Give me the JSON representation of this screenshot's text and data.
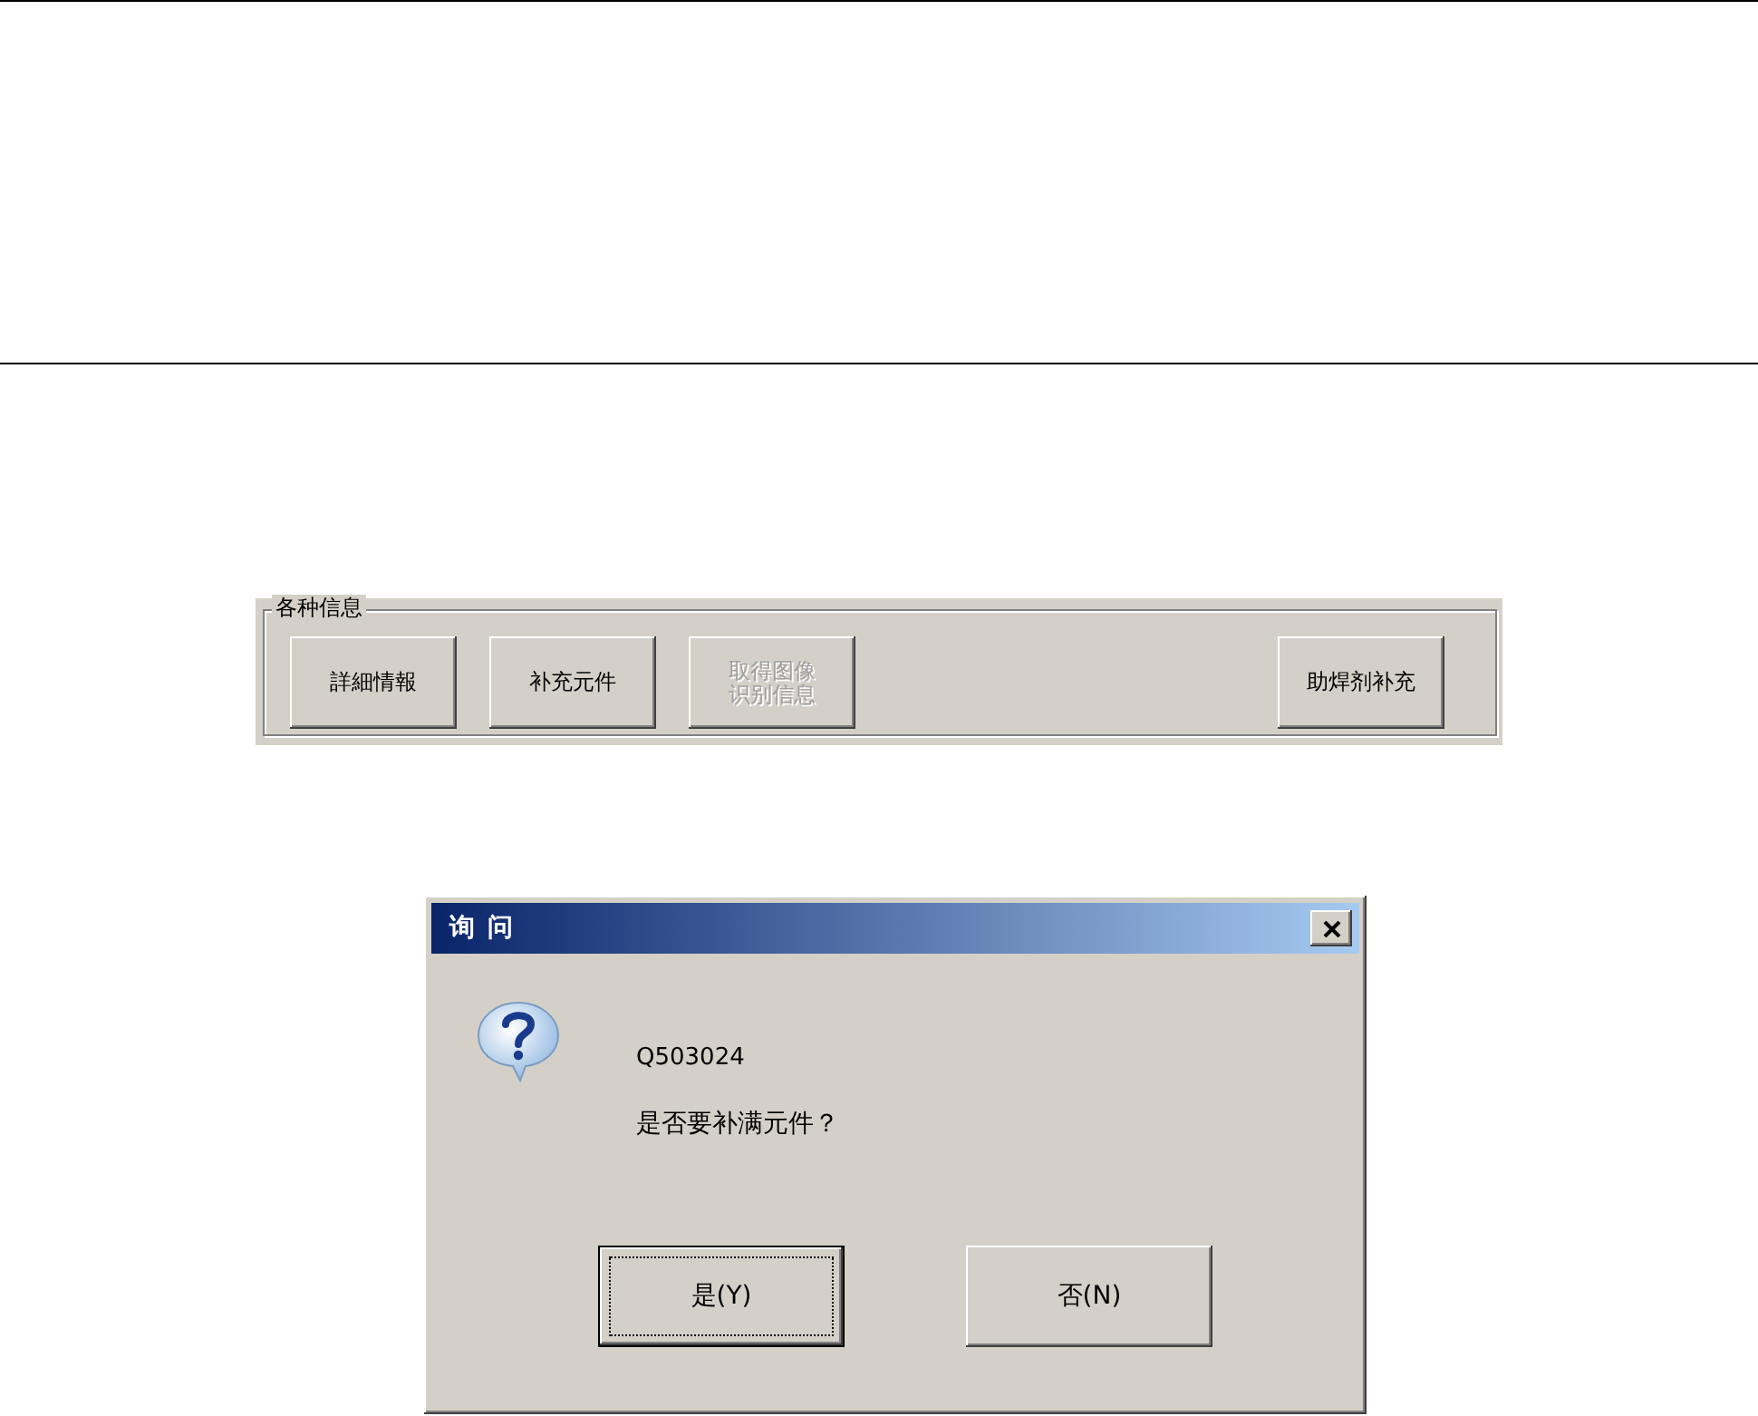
{
  "info_panel": {
    "title": "各种信息",
    "buttons": [
      {
        "label": "詳細情報",
        "disabled": false
      },
      {
        "label": "补充元件",
        "disabled": false
      },
      {
        "label": "取得图像识别信息",
        "disabled": true
      },
      {
        "label": "助焊剂补充",
        "disabled": false
      }
    ]
  },
  "dialog": {
    "title": "询 问",
    "code": "Q503024",
    "message": "是否要补满元件？",
    "buttons": [
      {
        "label": "是(Y)",
        "default": true
      },
      {
        "label": "否(N)",
        "default": false
      }
    ]
  }
}
